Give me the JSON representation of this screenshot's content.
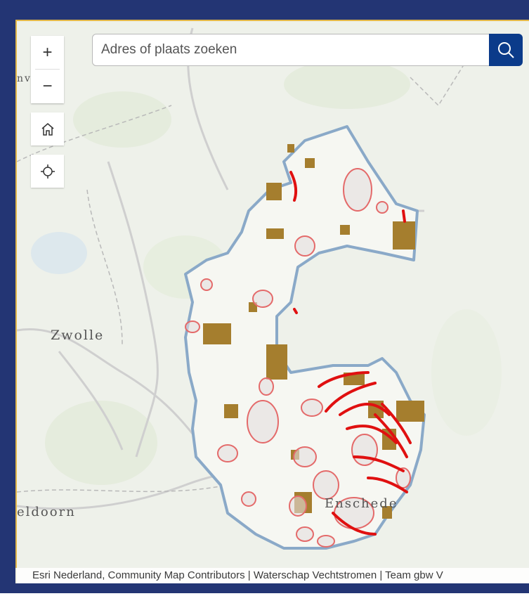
{
  "search": {
    "placeholder": "Adres of plaats zoeken"
  },
  "controls": {
    "zoom_in": "+",
    "zoom_out": "−"
  },
  "places": {
    "zwolle": "Zwolle",
    "enschede": "Enschede",
    "apeldoorn": "eldoorn",
    "partial": "nv"
  },
  "attribution": "Esri Nederland, Community Map Contributors | Waterschap Vechtstromen | Team gbw V",
  "colors": {
    "boundary": "#8aa9c8",
    "zone_outline": "#e46a6a",
    "brown_area": "#a57e2e",
    "red_line": "#e01010",
    "frame": "#233574",
    "search_button": "#0b3b8a"
  }
}
